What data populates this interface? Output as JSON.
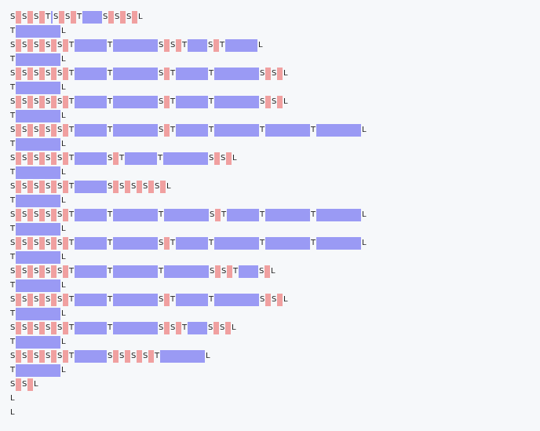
{
  "colors": {
    "background": "#f6f8fa",
    "s_box": "#f0a0a0",
    "t_box": "#9a9af4",
    "text": "#222222"
  },
  "lines": [
    {
      "tokens": [
        {
          "k": "S",
          "w": 1
        },
        {
          "k": "S",
          "w": 1
        },
        {
          "k": "S",
          "w": 1
        },
        {
          "k": "T",
          "w": 0
        },
        {
          "k": "S",
          "w": 1
        },
        {
          "k": "S",
          "w": 1
        },
        {
          "k": "T",
          "w": 3
        },
        {
          "k": "S",
          "w": 1
        },
        {
          "k": "S",
          "w": 1
        },
        {
          "k": "S",
          "w": 1
        },
        {
          "k": "L"
        }
      ]
    },
    {
      "tokens": [
        {
          "k": "T",
          "w": 7
        },
        {
          "k": "L"
        }
      ]
    },
    {
      "tokens": [
        {
          "k": "S",
          "w": 1
        },
        {
          "k": "S",
          "w": 1
        },
        {
          "k": "S",
          "w": 1
        },
        {
          "k": "S",
          "w": 1
        },
        {
          "k": "S",
          "w": 1
        },
        {
          "k": "T",
          "w": 5
        },
        {
          "k": "T",
          "w": 7
        },
        {
          "k": "S",
          "w": 1
        },
        {
          "k": "S",
          "w": 1
        },
        {
          "k": "T",
          "w": 3
        },
        {
          "k": "S",
          "w": 1
        },
        {
          "k": "T",
          "w": 5
        },
        {
          "k": "L"
        }
      ]
    },
    {
      "tokens": [
        {
          "k": "T",
          "w": 7
        },
        {
          "k": "L"
        }
      ]
    },
    {
      "tokens": [
        {
          "k": "S",
          "w": 1
        },
        {
          "k": "S",
          "w": 1
        },
        {
          "k": "S",
          "w": 1
        },
        {
          "k": "S",
          "w": 1
        },
        {
          "k": "S",
          "w": 1
        },
        {
          "k": "T",
          "w": 5
        },
        {
          "k": "T",
          "w": 7
        },
        {
          "k": "S",
          "w": 1
        },
        {
          "k": "T",
          "w": 5
        },
        {
          "k": "T",
          "w": 7
        },
        {
          "k": "S",
          "w": 1
        },
        {
          "k": "S",
          "w": 1
        },
        {
          "k": "L"
        }
      ]
    },
    {
      "tokens": [
        {
          "k": "T",
          "w": 7
        },
        {
          "k": "L"
        }
      ]
    },
    {
      "tokens": [
        {
          "k": "S",
          "w": 1
        },
        {
          "k": "S",
          "w": 1
        },
        {
          "k": "S",
          "w": 1
        },
        {
          "k": "S",
          "w": 1
        },
        {
          "k": "S",
          "w": 1
        },
        {
          "k": "T",
          "w": 5
        },
        {
          "k": "T",
          "w": 7
        },
        {
          "k": "S",
          "w": 1
        },
        {
          "k": "T",
          "w": 5
        },
        {
          "k": "T",
          "w": 7
        },
        {
          "k": "S",
          "w": 1
        },
        {
          "k": "S",
          "w": 1
        },
        {
          "k": "L"
        }
      ]
    },
    {
      "tokens": [
        {
          "k": "T",
          "w": 7
        },
        {
          "k": "L"
        }
      ]
    },
    {
      "tokens": [
        {
          "k": "S",
          "w": 1
        },
        {
          "k": "S",
          "w": 1
        },
        {
          "k": "S",
          "w": 1
        },
        {
          "k": "S",
          "w": 1
        },
        {
          "k": "S",
          "w": 1
        },
        {
          "k": "T",
          "w": 5
        },
        {
          "k": "T",
          "w": 7
        },
        {
          "k": "S",
          "w": 1
        },
        {
          "k": "T",
          "w": 5
        },
        {
          "k": "T",
          "w": 7
        },
        {
          "k": "T",
          "w": 7
        },
        {
          "k": "T",
          "w": 7
        },
        {
          "k": "L"
        }
      ]
    },
    {
      "tokens": [
        {
          "k": "T",
          "w": 7
        },
        {
          "k": "L"
        }
      ]
    },
    {
      "tokens": [
        {
          "k": "S",
          "w": 1
        },
        {
          "k": "S",
          "w": 1
        },
        {
          "k": "S",
          "w": 1
        },
        {
          "k": "S",
          "w": 1
        },
        {
          "k": "S",
          "w": 1
        },
        {
          "k": "T",
          "w": 5
        },
        {
          "k": "S",
          "w": 1
        },
        {
          "k": "T",
          "w": 5
        },
        {
          "k": "T",
          "w": 7
        },
        {
          "k": "S",
          "w": 1
        },
        {
          "k": "S",
          "w": 1
        },
        {
          "k": "L"
        }
      ]
    },
    {
      "tokens": [
        {
          "k": "T",
          "w": 7
        },
        {
          "k": "L"
        }
      ]
    },
    {
      "tokens": [
        {
          "k": "S",
          "w": 1
        },
        {
          "k": "S",
          "w": 1
        },
        {
          "k": "S",
          "w": 1
        },
        {
          "k": "S",
          "w": 1
        },
        {
          "k": "S",
          "w": 1
        },
        {
          "k": "T",
          "w": 5
        },
        {
          "k": "S",
          "w": 1
        },
        {
          "k": "S",
          "w": 1
        },
        {
          "k": "S",
          "w": 1
        },
        {
          "k": "S",
          "w": 1
        },
        {
          "k": "S",
          "w": 1
        },
        {
          "k": "L"
        }
      ]
    },
    {
      "tokens": [
        {
          "k": "T",
          "w": 7
        },
        {
          "k": "L"
        }
      ]
    },
    {
      "tokens": [
        {
          "k": "S",
          "w": 1
        },
        {
          "k": "S",
          "w": 1
        },
        {
          "k": "S",
          "w": 1
        },
        {
          "k": "S",
          "w": 1
        },
        {
          "k": "S",
          "w": 1
        },
        {
          "k": "T",
          "w": 5
        },
        {
          "k": "T",
          "w": 7
        },
        {
          "k": "T",
          "w": 7
        },
        {
          "k": "S",
          "w": 1
        },
        {
          "k": "T",
          "w": 5
        },
        {
          "k": "T",
          "w": 7
        },
        {
          "k": "T",
          "w": 7
        },
        {
          "k": "L"
        }
      ]
    },
    {
      "tokens": [
        {
          "k": "T",
          "w": 7
        },
        {
          "k": "L"
        }
      ]
    },
    {
      "tokens": [
        {
          "k": "S",
          "w": 1
        },
        {
          "k": "S",
          "w": 1
        },
        {
          "k": "S",
          "w": 1
        },
        {
          "k": "S",
          "w": 1
        },
        {
          "k": "S",
          "w": 1
        },
        {
          "k": "T",
          "w": 5
        },
        {
          "k": "T",
          "w": 7
        },
        {
          "k": "S",
          "w": 1
        },
        {
          "k": "T",
          "w": 5
        },
        {
          "k": "T",
          "w": 7
        },
        {
          "k": "T",
          "w": 7
        },
        {
          "k": "T",
          "w": 7
        },
        {
          "k": "L"
        }
      ]
    },
    {
      "tokens": [
        {
          "k": "T",
          "w": 7
        },
        {
          "k": "L"
        }
      ]
    },
    {
      "tokens": [
        {
          "k": "S",
          "w": 1
        },
        {
          "k": "S",
          "w": 1
        },
        {
          "k": "S",
          "w": 1
        },
        {
          "k": "S",
          "w": 1
        },
        {
          "k": "S",
          "w": 1
        },
        {
          "k": "T",
          "w": 5
        },
        {
          "k": "T",
          "w": 7
        },
        {
          "k": "T",
          "w": 7
        },
        {
          "k": "S",
          "w": 1
        },
        {
          "k": "S",
          "w": 1
        },
        {
          "k": "T",
          "w": 3
        },
        {
          "k": "S",
          "w": 1
        },
        {
          "k": "L"
        }
      ]
    },
    {
      "tokens": [
        {
          "k": "T",
          "w": 7
        },
        {
          "k": "L"
        }
      ]
    },
    {
      "tokens": [
        {
          "k": "S",
          "w": 1
        },
        {
          "k": "S",
          "w": 1
        },
        {
          "k": "S",
          "w": 1
        },
        {
          "k": "S",
          "w": 1
        },
        {
          "k": "S",
          "w": 1
        },
        {
          "k": "T",
          "w": 5
        },
        {
          "k": "T",
          "w": 7
        },
        {
          "k": "S",
          "w": 1
        },
        {
          "k": "T",
          "w": 5
        },
        {
          "k": "T",
          "w": 7
        },
        {
          "k": "S",
          "w": 1
        },
        {
          "k": "S",
          "w": 1
        },
        {
          "k": "L"
        }
      ]
    },
    {
      "tokens": [
        {
          "k": "T",
          "w": 7
        },
        {
          "k": "L"
        }
      ]
    },
    {
      "tokens": [
        {
          "k": "S",
          "w": 1
        },
        {
          "k": "S",
          "w": 1
        },
        {
          "k": "S",
          "w": 1
        },
        {
          "k": "S",
          "w": 1
        },
        {
          "k": "S",
          "w": 1
        },
        {
          "k": "T",
          "w": 5
        },
        {
          "k": "T",
          "w": 7
        },
        {
          "k": "S",
          "w": 1
        },
        {
          "k": "S",
          "w": 1
        },
        {
          "k": "T",
          "w": 3
        },
        {
          "k": "S",
          "w": 1
        },
        {
          "k": "S",
          "w": 1
        },
        {
          "k": "L"
        }
      ]
    },
    {
      "tokens": [
        {
          "k": "T",
          "w": 7
        },
        {
          "k": "L"
        }
      ]
    },
    {
      "tokens": [
        {
          "k": "S",
          "w": 1
        },
        {
          "k": "S",
          "w": 1
        },
        {
          "k": "S",
          "w": 1
        },
        {
          "k": "S",
          "w": 1
        },
        {
          "k": "S",
          "w": 1
        },
        {
          "k": "T",
          "w": 5
        },
        {
          "k": "S",
          "w": 1
        },
        {
          "k": "S",
          "w": 1
        },
        {
          "k": "S",
          "w": 1
        },
        {
          "k": "S",
          "w": 1
        },
        {
          "k": "T",
          "w": 7
        },
        {
          "k": "L"
        }
      ]
    },
    {
      "tokens": [
        {
          "k": "T",
          "w": 7
        },
        {
          "k": "L"
        }
      ]
    },
    {
      "tokens": [
        {
          "k": "S",
          "w": 1
        },
        {
          "k": "S",
          "w": 1
        },
        {
          "k": "L"
        }
      ]
    },
    {
      "tokens": [
        {
          "k": "L"
        }
      ]
    },
    {
      "tokens": [
        {
          "k": "L"
        }
      ]
    }
  ]
}
